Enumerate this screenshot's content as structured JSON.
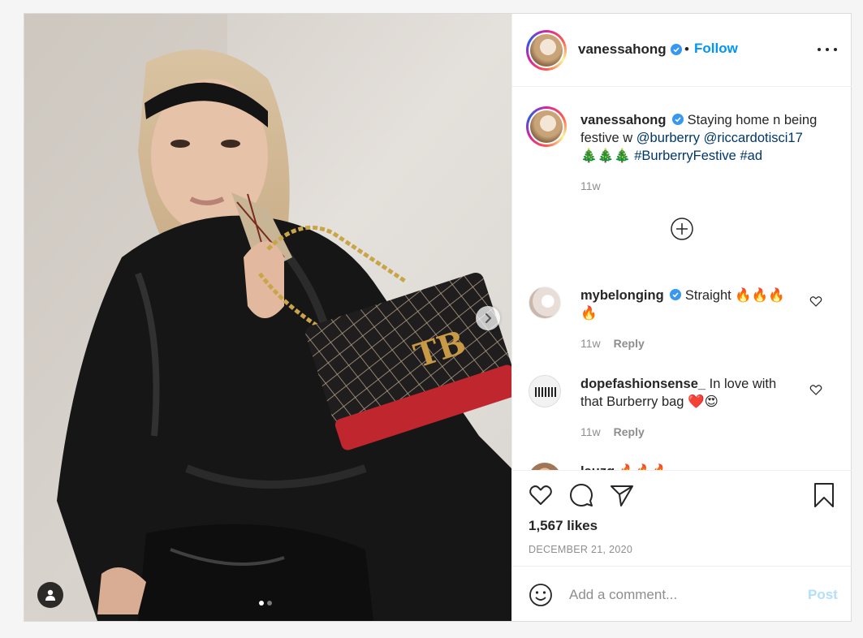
{
  "post": {
    "username": "vanessahong",
    "bullet": "•",
    "follow_label": "Follow",
    "more_icon": "more-options-icon"
  },
  "caption": {
    "username": "vanessahong",
    "text_1": " Staying home n being festive w ",
    "mention_1": "@burberry",
    "space": " ",
    "mention_2": "@riccardotisci17",
    "trees": "🎄🎄🎄",
    "space2": " ",
    "hashtag_1": "#BurberryFestive",
    "space3": " ",
    "hashtag_2": "#ad",
    "time": "11w"
  },
  "comments": [
    {
      "username": "mybelonging",
      "verified": true,
      "text": " Straight 🔥🔥🔥🔥",
      "time": "11w",
      "reply_label": "Reply"
    },
    {
      "username": "dopefashionsense_",
      "verified": false,
      "text": " In love with that Burberry bag ❤️😍",
      "time": "11w",
      "reply_label": "Reply"
    },
    {
      "username": "lauzg",
      "verified": false,
      "text": "  🔥🔥🔥",
      "time": "",
      "reply_label": ""
    }
  ],
  "stats": {
    "likes": "1,567 likes",
    "date": "DECEMBER 21, 2020"
  },
  "compose": {
    "placeholder": "Add a comment...",
    "post_label": "Post"
  },
  "colors": {
    "accent": "#0095f6",
    "link": "#00376b",
    "muted": "#8e8e8e",
    "post_disabled": "#b2dffc"
  }
}
